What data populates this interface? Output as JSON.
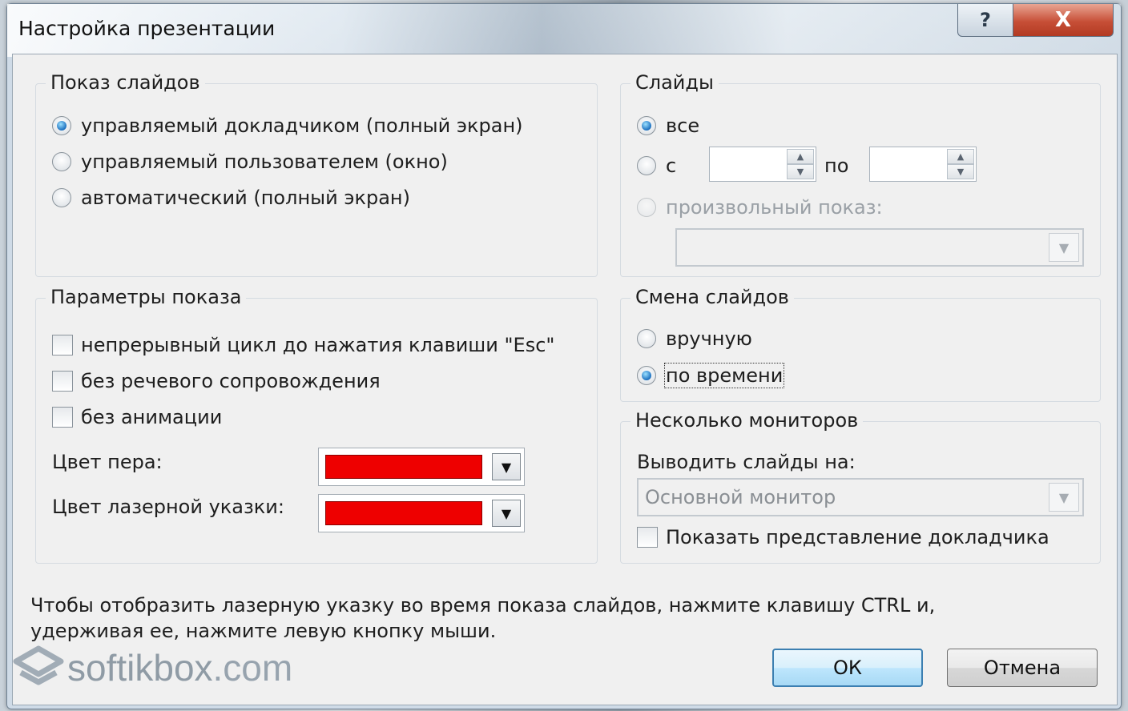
{
  "window": {
    "title": "Настройка презентации",
    "help_label": "?",
    "close_label": "X"
  },
  "show_type": {
    "legend": "Показ слайдов",
    "options": [
      {
        "label": "управляемый докладчиком (полный экран)",
        "checked": true
      },
      {
        "label": "управляемый пользователем (окно)",
        "checked": false
      },
      {
        "label": "автоматический (полный экран)",
        "checked": false
      }
    ]
  },
  "slides": {
    "legend": "Слайды",
    "all_label": "все",
    "from_label": "с",
    "from_value": "",
    "to_label": "по",
    "to_value": "",
    "custom_label": "произвольный показ:",
    "custom_value": "",
    "selected": "all"
  },
  "show_options": {
    "legend": "Параметры показа",
    "checkboxes": [
      {
        "label": "непрерывный цикл до нажатия клавиши \"Esc\"",
        "checked": false
      },
      {
        "label": "без речевого сопровождения",
        "checked": false
      },
      {
        "label": "без анимации",
        "checked": false
      }
    ],
    "pen_color_label": "Цвет пера:",
    "pen_color": "#ee0000",
    "laser_color_label": "Цвет лазерной указки:",
    "laser_color": "#ee0000"
  },
  "advance": {
    "legend": "Смена слайдов",
    "manual_label": "вручную",
    "timings_label": "по времени",
    "selected": "timings"
  },
  "monitors": {
    "legend": "Несколько мониторов",
    "display_on_label": "Выводить слайды на:",
    "display_on_value": "Основной монитор",
    "presenter_view_label": "Показать представление докладчика",
    "presenter_view_checked": false
  },
  "hint": {
    "line1": "Чтобы отобразить лазерную указку во время показа слайдов, нажмите клавишу CTRL и,",
    "line2": "удерживая ее, нажмите левую кнопку мыши."
  },
  "buttons": {
    "ok_label": "ОК",
    "cancel_label": "Отмена"
  },
  "watermark": {
    "brand": "softikbox",
    "tld": ".com"
  }
}
